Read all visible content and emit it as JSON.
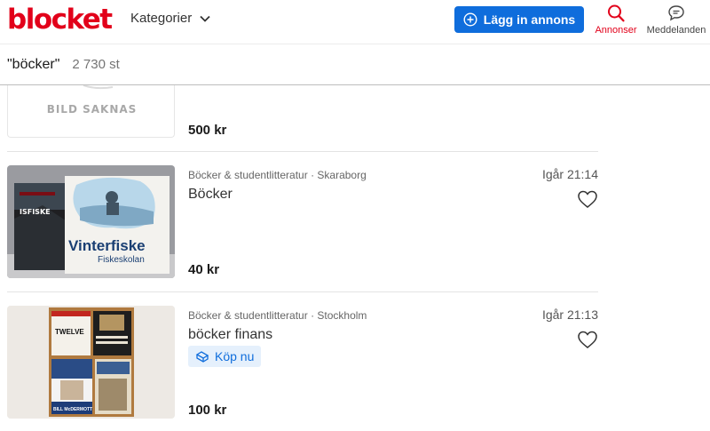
{
  "header": {
    "logo": "blocket",
    "categories_label": "Kategorier",
    "post_ad_label": "Lägg in annons",
    "ads_label": "Annonser",
    "messages_label": "Meddelanden"
  },
  "search": {
    "query": "\"böcker\"",
    "count": "2 730 st"
  },
  "listings": [
    {
      "image_text": "BILD SAKNAS",
      "price": "500 kr"
    },
    {
      "meta": "Böcker & studentlitteratur · Skaraborg",
      "time": "Igår 21:14",
      "title": "Böcker",
      "price": "40 kr",
      "image_text_1": "ISFISKE",
      "image_text_2": "Vinterfiske",
      "image_text_3": "Fiskeskolan"
    },
    {
      "meta": "Böcker & studentlitteratur · Stockholm",
      "time": "Igår 21:13",
      "title": "böcker finans",
      "badge": "Köp nu",
      "price": "100 kr",
      "image_text_1": "TWELVE",
      "image_text_2": "BILL McDERMOTT"
    }
  ],
  "colors": {
    "brand_red": "#e2001a",
    "button_blue": "#0f6ddc"
  }
}
